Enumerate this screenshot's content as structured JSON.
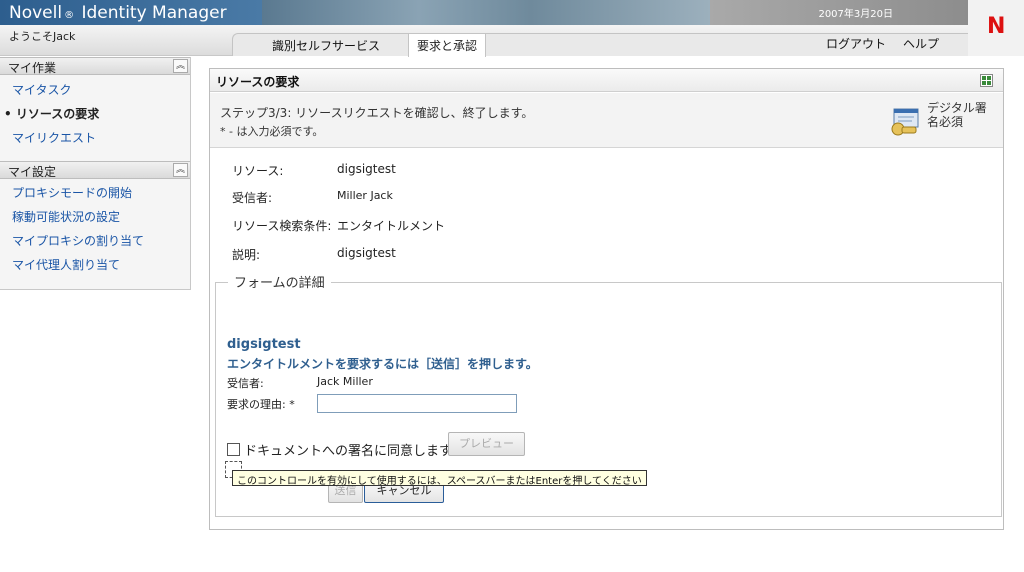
{
  "header": {
    "brand_name": "Novell",
    "brand_mark": "®",
    "brand_product": "Identity Manager",
    "date": "2007年3月20日",
    "welcome": "ようこそJack",
    "logo_letter": "N",
    "tabs": [
      {
        "label": "識別セルフサービス",
        "active": false
      },
      {
        "label": "要求と承認",
        "active": true
      }
    ],
    "logout": "ログアウト",
    "help": "ヘルプ"
  },
  "sidebar": {
    "section1": {
      "title": "マイ作業",
      "items": [
        "マイタスク",
        "リソースの要求",
        "マイリクエスト"
      ],
      "current_index": 1
    },
    "section2": {
      "title": "マイ設定",
      "items": [
        "プロキシモードの開始",
        "稼動可能状況の設定",
        "マイプロキシの割り当て",
        "マイ代理人割り当て"
      ]
    },
    "collapse_icon": "chevron-up-double-icon"
  },
  "panel": {
    "title": "リソースの要求",
    "step_text": "ステップ3/3: リソースリクエストを確認し、終了します。",
    "required_note": "* - は入力必須です。",
    "signature_label": "デジタル署名必須",
    "rows": [
      {
        "label": "リソース:",
        "value": "digsigtest"
      },
      {
        "label": "受信者:",
        "value": "Miller Jack"
      },
      {
        "label": "リソース検索条件:",
        "value": "エンタイトルメント"
      },
      {
        "label": "説明:",
        "value": "digsigtest"
      }
    ],
    "form": {
      "legend": "フォームの詳細",
      "title": "digsigtest",
      "instruction": "エンタイトルメントを要求するには［送信］を押します。",
      "recipient_label": "受信者:",
      "recipient_value": "Jack Miller",
      "reason_label": "要求の理由: *",
      "reason_value": "",
      "agree_label": "ドキュメントへの署名に同意します",
      "preview_button": "プレビュー",
      "submit_button": "送信",
      "cancel_button": "キャンセル",
      "tooltip": "このコントロールを有効にして使用するには、スペースバーまたはEnterを押してください"
    }
  }
}
